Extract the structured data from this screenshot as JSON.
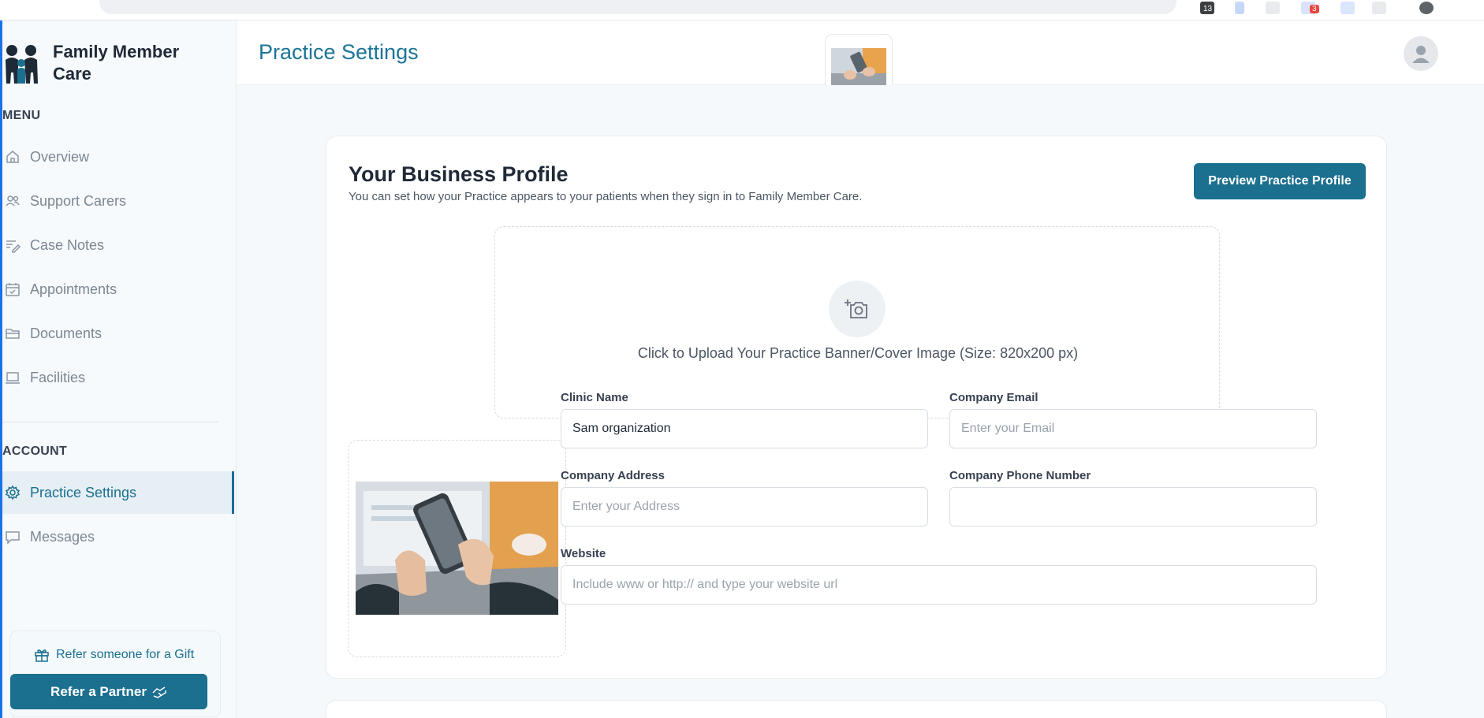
{
  "brand": {
    "name": "Family Member Care"
  },
  "sidebar": {
    "menu_label": "MENU",
    "items": [
      {
        "label": "Overview",
        "icon": "home-icon"
      },
      {
        "label": "Support Carers",
        "icon": "users-icon"
      },
      {
        "label": "Case Notes",
        "icon": "notes-icon"
      },
      {
        "label": "Appointments",
        "icon": "calendar-check-icon"
      },
      {
        "label": "Documents",
        "icon": "folder-icon"
      },
      {
        "label": "Facilities",
        "icon": "laptop-icon"
      }
    ],
    "account_label": "ACCOUNT",
    "account_items": [
      {
        "label": "Practice Settings",
        "icon": "gear-icon",
        "active": true
      },
      {
        "label": "Messages",
        "icon": "chat-icon"
      }
    ],
    "gift_text": "Refer someone for a Gift",
    "refer_button": "Refer a Partner"
  },
  "header": {
    "title": "Practice Settings"
  },
  "profile": {
    "title": "Your Business Profile",
    "subtitle": "You can set how your Practice appears to your patients when they sign in to Family Member Care.",
    "preview_button": "Preview Practice Profile",
    "banner_upload_text": "Click to Upload Your Practice Banner/Cover Image (Size: 820x200 px)",
    "fields": {
      "clinic_name": {
        "label": "Clinic Name",
        "value": "Sam organization",
        "placeholder": ""
      },
      "company_email": {
        "label": "Company Email",
        "value": "",
        "placeholder": "Enter your Email"
      },
      "company_address": {
        "label": "Company Address",
        "value": "",
        "placeholder": "Enter your Address"
      },
      "company_phone": {
        "label": "Company Phone Number",
        "value": "",
        "placeholder": ""
      },
      "website": {
        "label": "Website",
        "value": "",
        "placeholder": "Include www or http:// and type your website url"
      }
    }
  },
  "chrome": {
    "badge_a": "13",
    "badge_b": "3"
  },
  "colors": {
    "accent": "#1b6f8f",
    "title": "#1b7496",
    "edge": "#1a73e8"
  }
}
